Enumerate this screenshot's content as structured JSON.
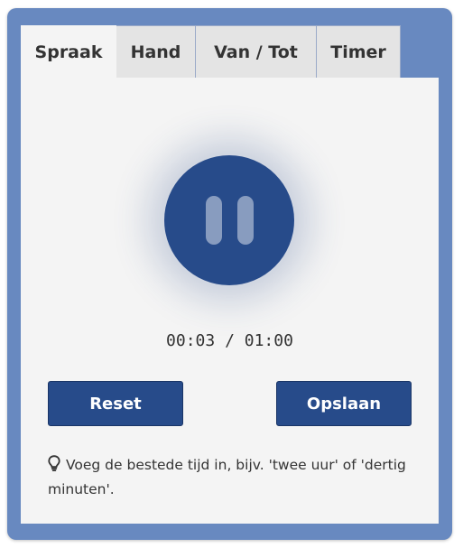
{
  "tabs": [
    {
      "label": "Spraak",
      "active": true
    },
    {
      "label": "Hand",
      "active": false
    },
    {
      "label": "Van / Tot",
      "active": false
    },
    {
      "label": "Timer",
      "active": false
    }
  ],
  "recorder": {
    "state_icon": "pause-icon",
    "elapsed": "00:03 / 01:00"
  },
  "buttons": {
    "reset_label": "Reset",
    "save_label": "Opslaan"
  },
  "hint": {
    "icon": "lightbulb-icon",
    "text": "Voeg de bestede tijd in, bijv. 'twee uur' of 'dertig minuten'."
  },
  "colors": {
    "frame": "#6889c0",
    "accent": "#274b8a",
    "panel": "#f4f4f4"
  }
}
